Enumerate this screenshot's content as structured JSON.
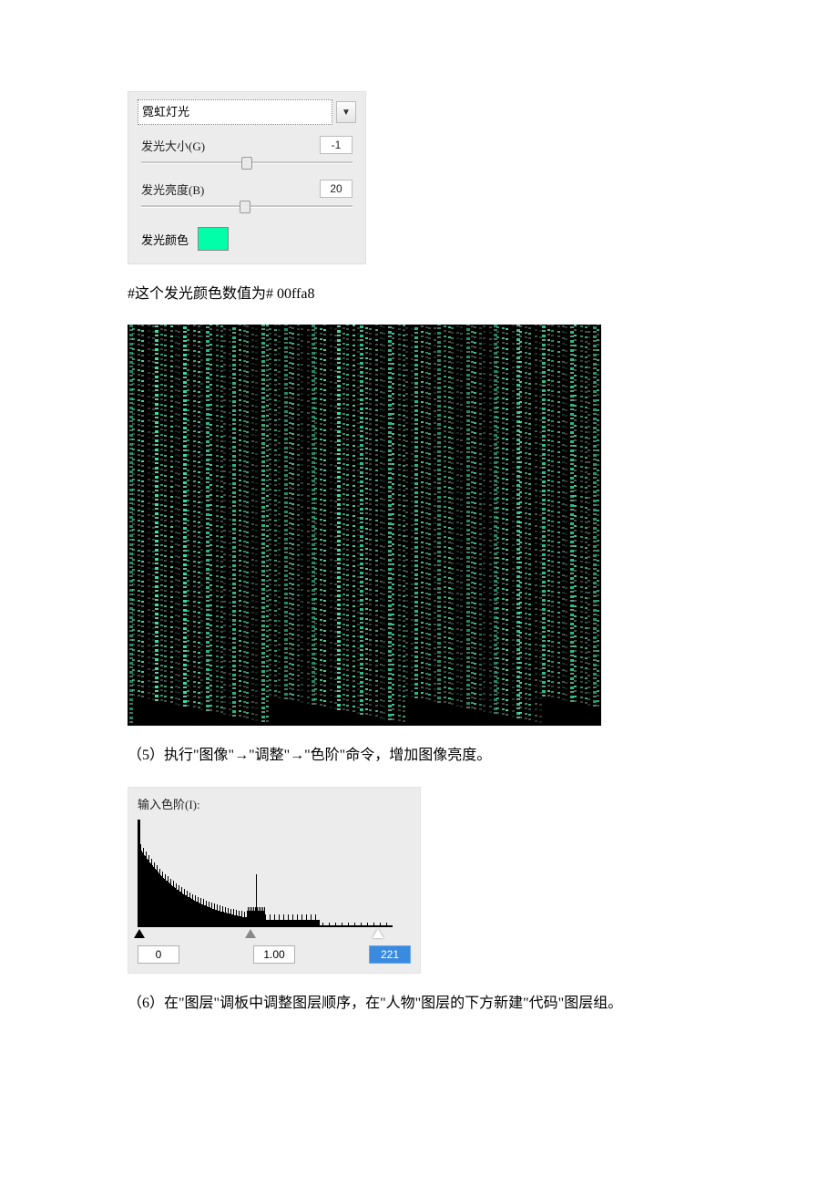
{
  "panel": {
    "dropdown_value": "霓虹灯光",
    "glow_size_label": "发光大小(G)",
    "glow_size_value": "-1",
    "glow_brightness_label": "发光亮度(B)",
    "glow_brightness_value": "20",
    "glow_color_label": "发光颜色",
    "glow_color_hex": "#00ffa8"
  },
  "text": {
    "color_note": "#这个发光颜色数值为# 00ffa8",
    "step5": "（5）执行\"图像\"→\"调整\"→\"色阶\"命令，增加图像亮度。",
    "step6": "（6）在\"图层\"调板中调整图层顺序，在\"人物\"图层的下方新建\"代码\"图层组。"
  },
  "levels": {
    "label": "输入色阶(I):",
    "shadow": "0",
    "mid": "1.00",
    "highlight": "221"
  }
}
